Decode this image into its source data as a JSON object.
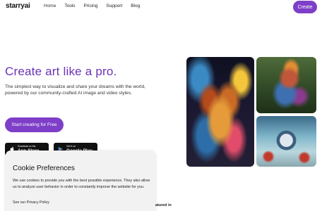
{
  "header": {
    "logo": "starryai",
    "nav": [
      "Home",
      "Tools",
      "Pricing",
      "Support",
      "Blog"
    ],
    "create_label": "Create"
  },
  "hero": {
    "title": "Create art like a pro.",
    "subtitle": "The simplest way to visualize and share your dreams with the world, powered by our community-crafted AI image and video styles.",
    "cta_label": "Start creating for Free",
    "app_store": {
      "small": "Download on the",
      "big": "App Store"
    },
    "google_play": {
      "small": "Get it on",
      "big": "Google Play"
    }
  },
  "gallery": {
    "images": [
      "tiger-artwork",
      "bird-artwork",
      "clock-artwork"
    ]
  },
  "cookie": {
    "title": "Cookie Preferences",
    "body": "We use cookies to provide you with the best possible experience. They also allow us to analyze user behavior in order to constantly improve the website for you.",
    "link": "See our Privacy Policy"
  },
  "featured_text": "atured in",
  "colors": {
    "accent": "#7e3fc8",
    "title": "#6a32b8",
    "cookie_bg": "#f2f2f2"
  }
}
